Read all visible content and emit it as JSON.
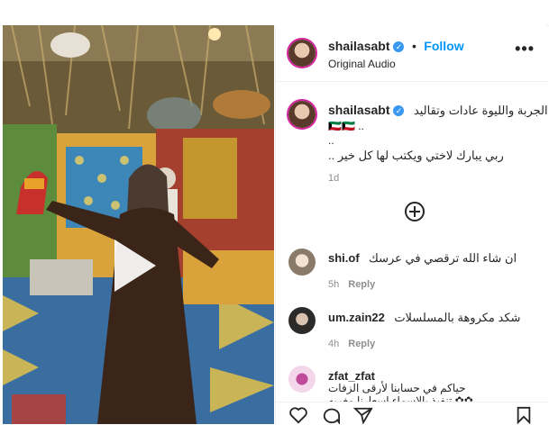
{
  "post": {
    "author": "shailasabt",
    "verified_mark": "✓",
    "follow_label": "Follow",
    "separator": "•",
    "audio": "Original Audio",
    "more_icon": "•••"
  },
  "caption": {
    "author": "shailasabt",
    "line1": "الجربة والليوة عادات وتقاليد",
    "emoji": "🇰🇼🇰🇼 ..",
    "line2": "..",
    "line3": "ربي يبارك لاختي ويكتب لها كل خير ..",
    "time": "1d"
  },
  "comments": [
    {
      "user": "shi.of",
      "text": "ان شاء الله ترقصي في عرسك",
      "time": "5h",
      "reply": "Reply"
    },
    {
      "user": "um.zain22",
      "text": "شكد مكروهة بالمسلسلات",
      "time": "4h",
      "reply": "Reply"
    },
    {
      "user": "zfat_zfat",
      "text": "حياكم في حسابنا لأرقى الزفات",
      "text2": "✿✿ تنفيذ بالاسماء إسعارنا مغريه",
      "time": "",
      "reply": ""
    }
  ],
  "icons": {
    "like": "heart-icon",
    "comment": "comment-icon",
    "share": "share-icon",
    "save": "bookmark-icon",
    "load_more": "plus-circle-icon",
    "play": "play-icon"
  }
}
